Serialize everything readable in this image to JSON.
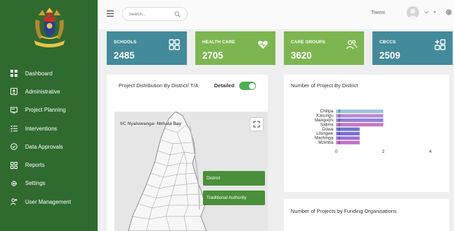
{
  "sidebar": {
    "items": [
      {
        "label": "Dashboard",
        "icon": "dashboard-icon"
      },
      {
        "label": "Administrative",
        "icon": "id-card-icon"
      },
      {
        "label": "Project Planning",
        "icon": "monitor-icon"
      },
      {
        "label": "Interventions",
        "icon": "list-check-icon"
      },
      {
        "label": "Data Approvals",
        "icon": "shield-check-icon"
      },
      {
        "label": "Reports",
        "icon": "grid-plus-icon"
      },
      {
        "label": "Settings",
        "icon": "gear-icon"
      },
      {
        "label": "User Management",
        "icon": "user-plus-icon"
      }
    ]
  },
  "topbar": {
    "search_placeholder": "Search...",
    "username": "Tiwoni"
  },
  "cards": [
    {
      "label": "SCHOOLS",
      "value": "2485",
      "color": "#438a9a",
      "icon": "school-grid-icon"
    },
    {
      "label": "HEALTH CARE",
      "value": "2705",
      "color": "#7db651",
      "icon": "heart-pulse-icon"
    },
    {
      "label": "CARE GROUPS",
      "value": "3620",
      "color": "#7db651",
      "icon": "group-icon"
    },
    {
      "label": "CBCCS",
      "value": "2509",
      "color": "#438a9a",
      "icon": "grid-add-icon"
    }
  ],
  "distribution": {
    "title": "Project Distribution By District/ T/A",
    "detailed_label": "Detailed",
    "detailed_on": true,
    "map_caption": "SC Nyaluwanga- Nkhata Bay",
    "btn_district": "District",
    "btn_ta": "Traditional Authority"
  },
  "chart_panel": {
    "title": "Number of Project By District"
  },
  "chart_data": {
    "type": "bar",
    "orientation": "horizontal",
    "title": "Number of Project By District",
    "categories": [
      "Chitipa",
      "Kasungu",
      "Mangochi",
      "Salima",
      "Dowa",
      "Lilongwe",
      "Machinga",
      "Mzimba"
    ],
    "values": [
      2,
      2,
      2,
      2,
      1,
      1,
      1,
      1
    ],
    "data_labels": [
      "2",
      "2",
      "2",
      "2",
      "1",
      "1",
      "1",
      "1"
    ],
    "bar_colors": [
      "#9ec2e6",
      "#b48ad8",
      "#8e82d9",
      "#c577c7",
      "#6f73d4",
      "#7b6fd8",
      "#9b72d9",
      "#c46fc9"
    ],
    "xlim": [
      0,
      4
    ],
    "xticks": [
      "0",
      "2",
      "4"
    ],
    "grid": false
  },
  "funding_panel": {
    "title": "Number of Projects by Funding Organisations"
  }
}
